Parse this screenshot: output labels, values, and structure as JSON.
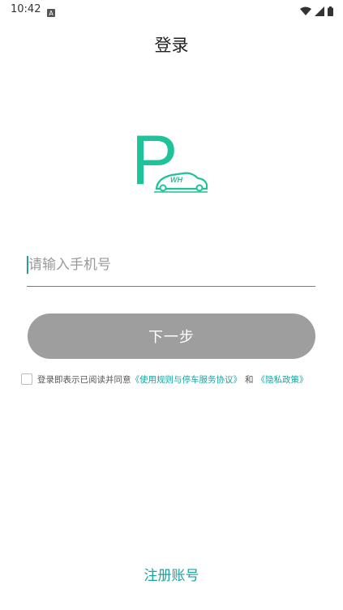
{
  "status_bar": {
    "time": "10:42",
    "icons": [
      "notification-a-icon",
      "wifi-icon",
      "signal-icon",
      "battery-icon"
    ]
  },
  "header": {
    "title": "登录"
  },
  "logo": {
    "letter": "P",
    "car_text": "WH",
    "brand_color": "#20c29a"
  },
  "form": {
    "phone_placeholder": "请输入手机号",
    "phone_value": "",
    "next_button_label": "下一步"
  },
  "agreement": {
    "prefix": "登录即表示已阅读并同意",
    "terms_link": "《使用规则与停车服务协议》",
    "conjunction": "和",
    "privacy_link": "《隐私政策》",
    "checked": false
  },
  "footer": {
    "register_label": "注册账号"
  },
  "colors": {
    "accent": "#1aa3a0",
    "button_disabled": "#9e9e9e"
  }
}
